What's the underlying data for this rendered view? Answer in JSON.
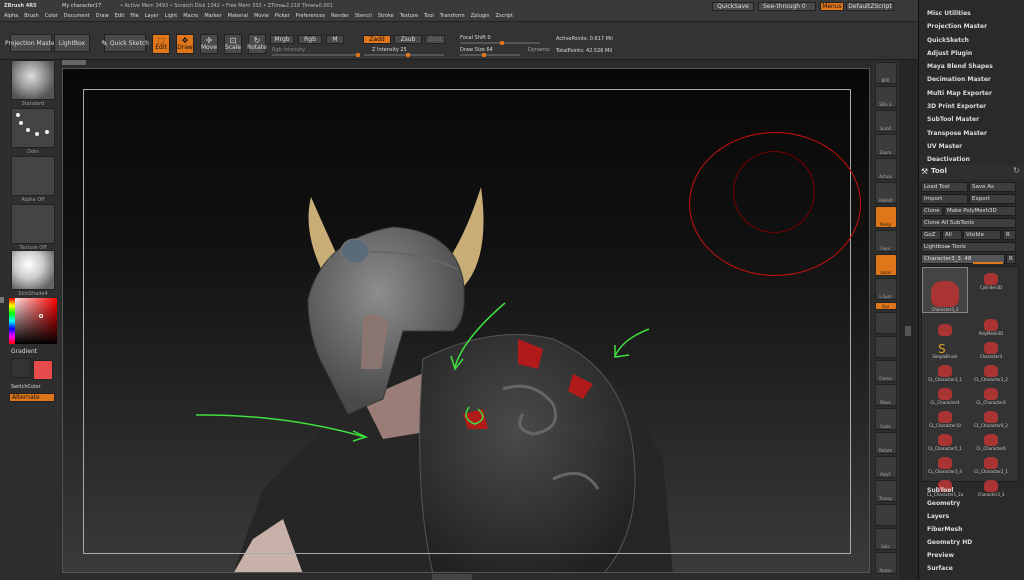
{
  "menubar": {
    "app": "ZBrush 4R5",
    "doc": "My character17",
    "stats": "• Active Mem 3493 • Scratch Disk 1342 • Free Mem 333 • ZTime▸2.218 Timer▸0.001",
    "menus": [
      "Alpha",
      "Brush",
      "Color",
      "Document",
      "Draw",
      "Edit",
      "File",
      "Layer",
      "Light",
      "Macro",
      "Marker",
      "Material",
      "Movie",
      "Picker",
      "Preferences",
      "Render",
      "Stencil",
      "Stroke",
      "Texture",
      "Tool",
      "Transform",
      "Zplugin",
      "Zscript"
    ],
    "quicksave": "QuickSave",
    "seethrough": "See-through",
    "seethrough_val": "0",
    "menus_btn": "Menus",
    "defaultzscript": "DefaultZScript"
  },
  "topbar": {
    "projection_master": "Projection Master",
    "lightbox": "LightBox",
    "quick_sketch": "Quick Sketch",
    "edit": "Edit",
    "draw": "Draw",
    "move": "Move",
    "scale": "Scale",
    "rotate": "Rotate",
    "mrgb": "Mrgb",
    "rgb": "Rgb",
    "m": "M",
    "rgb_intensity": "Rgb Intensity",
    "zadd": "Zadd",
    "zsub": "Zsub",
    "zcut": "Zcut",
    "z_intensity": "Z Intensity 25",
    "focal_shift": "Focal Shift 0",
    "draw_size": "Draw Size 64",
    "dynamic": "Dynamic",
    "active_points": "ActivePoints: 0.617 Mil",
    "total_points": "TotalPoints: 42.526 Mil"
  },
  "leftshelf": {
    "standard": "Standard",
    "dots": "Dots",
    "alpha_off": "Alpha Off",
    "texture_off": "Texture Off",
    "material": "SkinShade4",
    "gradient": "Gradient",
    "switchcolor": "SwitchColor",
    "alternate": "Alternate"
  },
  "rightshelf": {
    "icons": [
      "BPR",
      "SPix 3",
      "Scroll",
      "Zoom",
      "Actual",
      "AAHalf",
      "Persp",
      "Floor",
      "Local",
      "L.Sym",
      "Xyz",
      "",
      "",
      "Frame",
      "Move",
      "Scale",
      "Rotate",
      "PolyF",
      "Transp",
      "",
      "Solo",
      "Xpose"
    ]
  },
  "rpanel": {
    "plugins": [
      "Misc Utilities",
      "Projection Master",
      "QuickSketch",
      "Adjust Plugin",
      "Maya Blend Shapes",
      "Decimation Master",
      "Multi Map Exporter",
      "3D Print Exporter",
      "SubTool Master",
      "Transpose Master",
      "UV Master",
      "Deactivation"
    ],
    "tool_title": "Tool",
    "load_tool": "Load Tool",
    "save_as": "Save As",
    "import": "Import",
    "export": "Export",
    "clone": "Clone",
    "make_polymesh": "Make PolyMesh3D",
    "clone_all": "Clone All SubTools",
    "goz": "GoZ",
    "all": "All",
    "visible": "Visible",
    "r": "R",
    "lightbox_tools": "Lightbox▸ Tools",
    "current_tool": "Character3_3. 48",
    "tools": [
      "Character3_3",
      "Cylinder3D",
      "",
      "PolyMesh3D",
      "SimpleBrush",
      "Character3",
      "CL_Character3_1",
      "CL_Character3_2",
      "CL_Character4",
      "CL_Character3",
      "CL_Character10",
      "CL_Character9_2",
      "CL_Character5_1",
      "CL_Character6",
      "CL_Character3_4",
      "CL_Character2_1",
      "CL_Character1_2a",
      "Character3_3"
    ],
    "sections": [
      "SubTool",
      "Geometry",
      "Layers",
      "FiberMesh",
      "Geometry HD",
      "Preview",
      "Surface"
    ]
  },
  "colors": {
    "accent": "#e0761a",
    "main_color": "#e84b4b",
    "annotation": "#3fe03f",
    "brush_circle": "#cc1111"
  }
}
